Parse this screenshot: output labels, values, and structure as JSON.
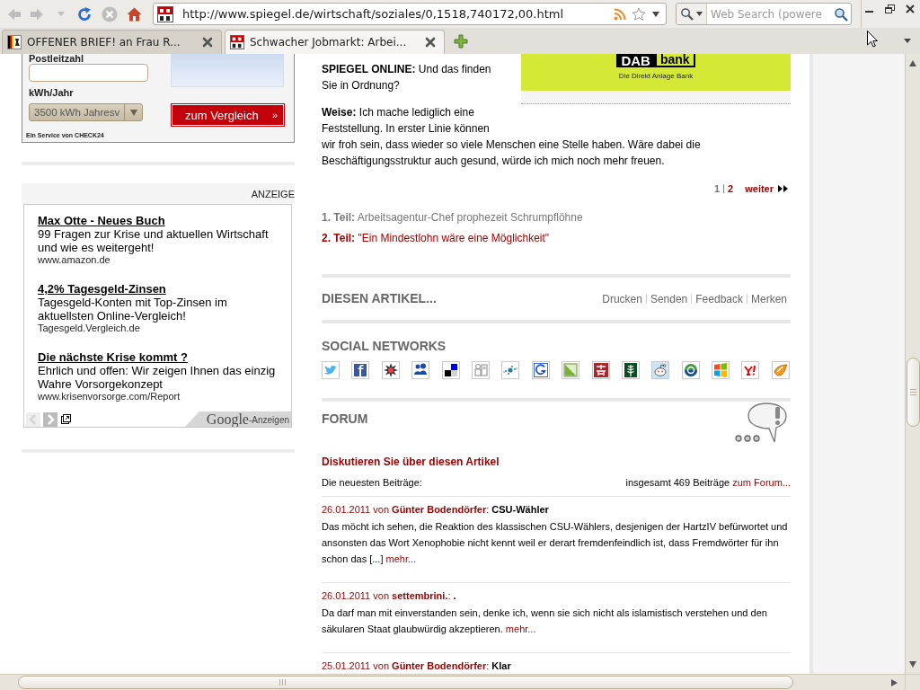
{
  "browser": {
    "nav_buttons": [
      {
        "kind": "back",
        "disabled": true
      },
      {
        "kind": "forward",
        "disabled": true
      },
      {
        "kind": "history",
        "disabled": true
      },
      {
        "kind": "reload",
        "disabled": false
      },
      {
        "kind": "stop",
        "disabled": true
      },
      {
        "kind": "home",
        "disabled": false
      }
    ],
    "url": "http://www.spiegel.de/wirtschaft/soziales/0,1518,740172,00.html",
    "search": {
      "placeholder": "Web Search (powere"
    },
    "tabs": [
      {
        "label": "OFFENER BRIEF! an Frau R...",
        "selected": false
      },
      {
        "label": "Schwacher Jobmarkt: Arbei...",
        "selected": true
      }
    ]
  },
  "comparison_widget": {
    "fields": [
      {
        "kind": "input",
        "label": "Postleitzahl"
      },
      {
        "kind": "select",
        "label": "kWh/Jahr",
        "value": "3500 kWh Jahresv"
      }
    ],
    "button": {
      "label": "zum Vergleich",
      "arrow": "»"
    },
    "footer": "Ein Service von CHECK24"
  },
  "text_ads": {
    "header": "ANZEIGE",
    "items": [
      {
        "title": "Max Otte - Neues Buch",
        "text": "99 Fragen zur Krise und aktuellen Wirtschaft und wie es weitergeht!",
        "url": "www.amazon.de"
      },
      {
        "title": "4,2% Tagesgeld-Zinsen",
        "text": "Tagesgeld-Konten mit Top-Zinsen im aktuellsten Online-Vergleich!",
        "url": "Tagesgeld.Vergleich.de"
      },
      {
        "title": "Die nächste Krise kommt ?",
        "text": "Ehrlich und offen: Wir zeigen Ihnen das einzig Wahre Vorsorgekonzept",
        "url": "www.krisenvorsorge.com/Report"
      }
    ],
    "nav": [
      {
        "kind": "prev",
        "disabled": true
      },
      {
        "kind": "next",
        "disabled": false
      }
    ],
    "attribution": {
      "logo": "Google",
      "label": "-Anzeigen"
    }
  },
  "banner": {
    "logo": [
      "DAB",
      "bank"
    ],
    "tagline": "Die Direkt Anlage Bank"
  },
  "article": {
    "paragraphs": [
      "**SPIEGEL ONLINE:** Und das finden Sie in Ordnung?",
      "**Weise:** Ich mache lediglich eine Feststellung. In erster Linie können wir froh sein, dass wieder so viele Menschen eine Stelle haben. Wäre dabei die Beschäftigungsstruktur auch gesund, würde ich mich noch mehr freuen."
    ],
    "pagination": {
      "pages": [
        {
          "label": "1",
          "selected": true
        },
        {
          "label": "2",
          "selected": false
        }
      ],
      "next": "weiter"
    },
    "parts": [
      {
        "label": "1. Teil:",
        "title": "Arbeitsagentur-Chef prophezeit Schrumpflöhne",
        "selected": true
      },
      {
        "label": "2. Teil:",
        "title": "\"Ein Mindestlohn wäre eine Möglichkeit\"",
        "selected": false
      }
    ]
  },
  "article_tools": {
    "title": "DIESEN ARTIKEL...",
    "actions": [
      "Drucken",
      "Senden",
      "Feedback",
      "Merken"
    ]
  },
  "social": {
    "title": "SOCIAL NETWORKS"
  },
  "forum": {
    "title": "FORUM",
    "discuss_link": "Diskutieren Sie über diesen Artikel",
    "latest_label": "Die neuesten Beiträge:",
    "total": "insgesamt 469 Beiträge",
    "forum_link": "zum Forum...",
    "posts": [
      {
        "byline": "26.01.2011 von",
        "author": "Günter Bodendörfer",
        "separator": ":",
        "title": "CSU-Wähler",
        "text": "Das möcht ich sehen, die Reaktion des klassischen CSU-Wählers, desjenigen der HartzIV befürwortet und ansonsten das Wort Xenophobie nicht kennt weil er derart fremdenfeindlich ist, dass Fremdwörter für ihn schon das [...]",
        "more": "mehr..."
      },
      {
        "byline": "26.01.2011 von",
        "author": "settembrini.",
        "separator": ":",
        "title": ".",
        "text": "Da darf man mit einverstanden sein, denke ich, wenn sie sich nicht als islamistisch verstehen und den säkularen Staat glaubwürdig akzeptieren.",
        "more": "mehr..."
      },
      {
        "byline": "25.01.2011 von",
        "author": "Günter Bodendörfer",
        "separator": ":",
        "title": "Klar"
      }
    ]
  }
}
